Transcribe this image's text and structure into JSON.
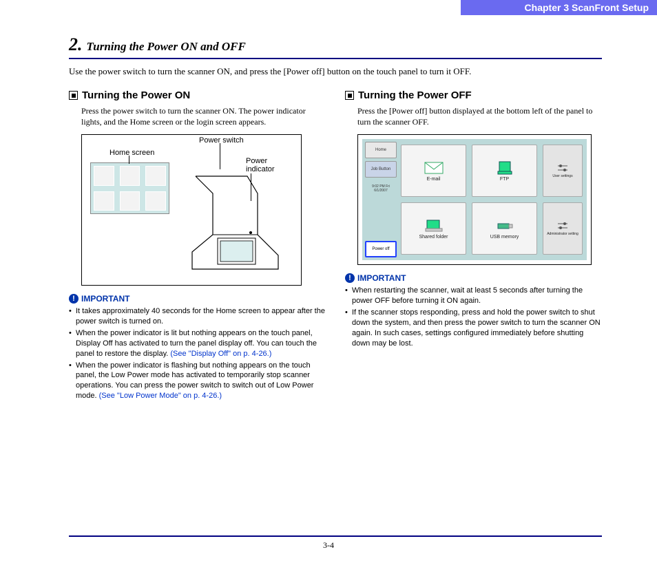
{
  "header": "Chapter 3   ScanFront Setup",
  "section": {
    "num": "2.",
    "title": "Turning the Power ON and OFF"
  },
  "intro": "Use the power switch to turn the scanner ON, and press the [Power off] button on the touch panel to turn it OFF.",
  "left": {
    "heading": "Turning the Power ON",
    "body": "Press the power switch to turn the scanner ON. The power indicator lights, and the Home screen or the login screen appears.",
    "labels": {
      "home": "Home screen",
      "pswitch": "Power switch",
      "pind": "Power\nindicator"
    },
    "important_label": "IMPORTANT",
    "bullets": [
      {
        "text": "It takes approximately 40 seconds for the Home screen to appear after the power switch is turned on."
      },
      {
        "text_a": "When the power indicator is lit but nothing appears on the touch panel, Display Off has activated to turn the panel display off. You can touch the panel to restore the display. ",
        "link": "(See \"Display Off\" on p. 4-26.)"
      },
      {
        "text_a": "When the power indicator is flashing but nothing appears on the touch panel, the Low Power mode has activated to temporarily stop scanner operations. You can press the power switch to switch out of Low Power mode. ",
        "link": "(See \"Low Power Mode\" on p. 4-26.)"
      }
    ]
  },
  "right": {
    "heading": "Turning the Power OFF",
    "body": "Press the [Power off] button displayed at the bottom left of the panel to turn the scanner OFF.",
    "sidebar": {
      "home": "Home",
      "job": "Job Button",
      "time1": "9:02 PM  Fri",
      "time2": "6/1/2007",
      "poweroff": "Power off"
    },
    "tiles": {
      "email": "E-mail",
      "ftp": "FTP",
      "user": "User settings",
      "shared": "Shared folder",
      "usb": "USB memory",
      "admin": "Administrator setting"
    },
    "important_label": "IMPORTANT",
    "bullets": [
      "When restarting the scanner, wait at least 5 seconds after turning the power OFF before turning it ON again.",
      "If the scanner stops responding, press and hold the power switch to shut down the system, and then press the power switch to turn the scanner ON again. In such cases, settings configured immediately before shutting down may be lost."
    ]
  },
  "page_number": "3-4"
}
